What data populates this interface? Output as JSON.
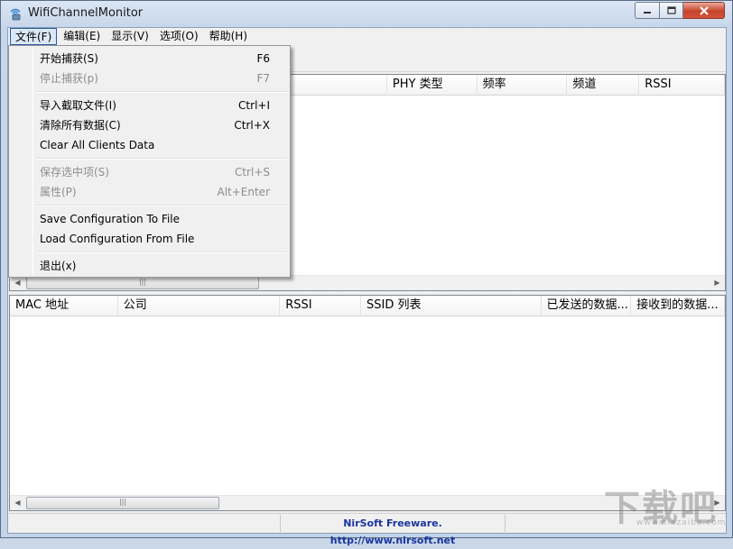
{
  "window": {
    "title": "WifiChannelMonitor"
  },
  "menubar": {
    "items": [
      "文件(F)",
      "编辑(E)",
      "显示(V)",
      "选项(O)",
      "帮助(H)"
    ]
  },
  "file_menu": {
    "items": [
      {
        "label": "开始捕获(S)",
        "shortcut": "F6",
        "disabled": false
      },
      {
        "label": "停止捕获(p)",
        "shortcut": "F7",
        "disabled": true
      },
      {
        "label": "导入截取文件(I)",
        "shortcut": "Ctrl+I",
        "disabled": false
      },
      {
        "label": "清除所有数据(C)",
        "shortcut": "Ctrl+X",
        "disabled": false
      },
      {
        "label": "Clear All Clients Data",
        "shortcut": "",
        "disabled": false
      },
      {
        "label": "保存选中项(S)",
        "shortcut": "Ctrl+S",
        "disabled": true
      },
      {
        "label": "属性(P)",
        "shortcut": "Alt+Enter",
        "disabled": true
      },
      {
        "label": "Save Configuration To File",
        "shortcut": "",
        "disabled": false
      },
      {
        "label": "Load Configuration From File",
        "shortcut": "",
        "disabled": false
      },
      {
        "label": "退出(x)",
        "shortcut": "",
        "disabled": false
      }
    ]
  },
  "top_list": {
    "columns": [
      "PHY 类型",
      "频率",
      "频道",
      "RSSI"
    ]
  },
  "bottom_list": {
    "columns": [
      "MAC 地址",
      "公司",
      "RSSI",
      "SSID 列表",
      "已发送的数据...",
      "接收到的数据..."
    ]
  },
  "status": {
    "link_text": "NirSoft Freeware.  http://www.nirsoft.net"
  },
  "watermark": {
    "text": "下载吧",
    "sub": "www.xiazaiba.com"
  },
  "colors": {
    "title_bar": "#c6d6eb",
    "close_button": "#c8432c",
    "link": "#1a35a0"
  },
  "icons": {
    "app": "wifi-monitor-icon",
    "minimize": "minimize-icon",
    "maximize": "maximize-icon",
    "close": "close-icon"
  }
}
